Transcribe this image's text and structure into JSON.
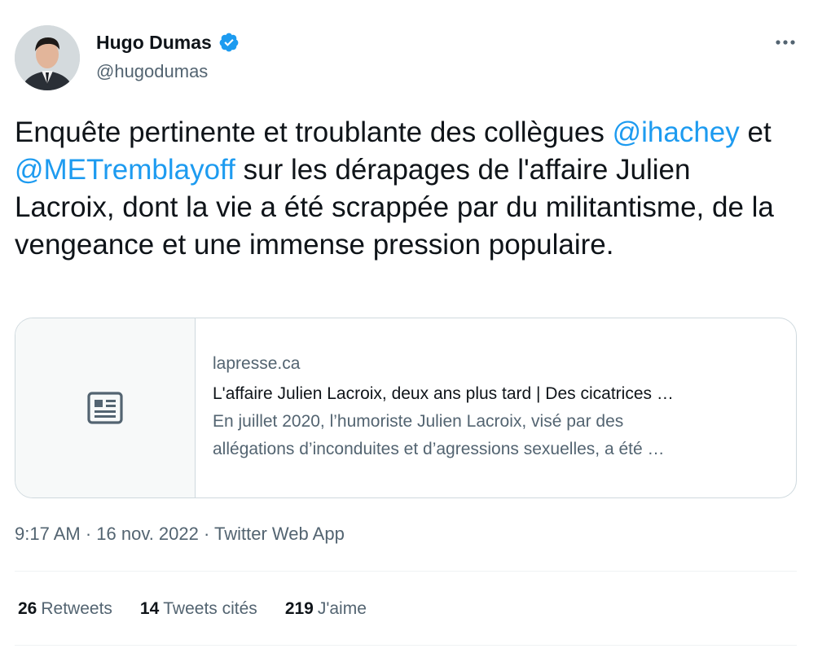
{
  "author": {
    "name": "Hugo Dumas",
    "handle": "@hugodumas",
    "verified": true
  },
  "tweet": {
    "text_part1": "Enquête pertinente et troublante des collègues ",
    "mention1": "@ihachey",
    "text_part2": " et ",
    "mention2": "@METremblayoff",
    "text_part3": " sur les dérapages de l'affaire Julien Lacroix, dont la vie a été scrappée par du militantisme, de la vengeance et une immense pression populaire."
  },
  "card": {
    "domain": "lapresse.ca",
    "title": "L'affaire Julien Lacroix, deux ans plus tard | Des cicatrices …",
    "description_line1": "En juillet 2020, l’humoriste Julien Lacroix, visé par des",
    "description_line2": "allégations d’inconduites et d’agressions sexuelles, a été …",
    "icon": "article-icon"
  },
  "meta": {
    "time": "9:17 AM",
    "sep1": " · ",
    "date": "16 nov. 2022",
    "sep2": " · ",
    "source": "Twitter Web App"
  },
  "stats": {
    "retweets_count": "26",
    "retweets_label": "Retweets",
    "quotes_count": "14",
    "quotes_label": "Tweets cités",
    "likes_count": "219",
    "likes_label": "J'aime"
  },
  "colors": {
    "accent": "#1d9bf0",
    "text": "#0f1419",
    "secondary": "#536471",
    "border": "#cfd9de"
  }
}
